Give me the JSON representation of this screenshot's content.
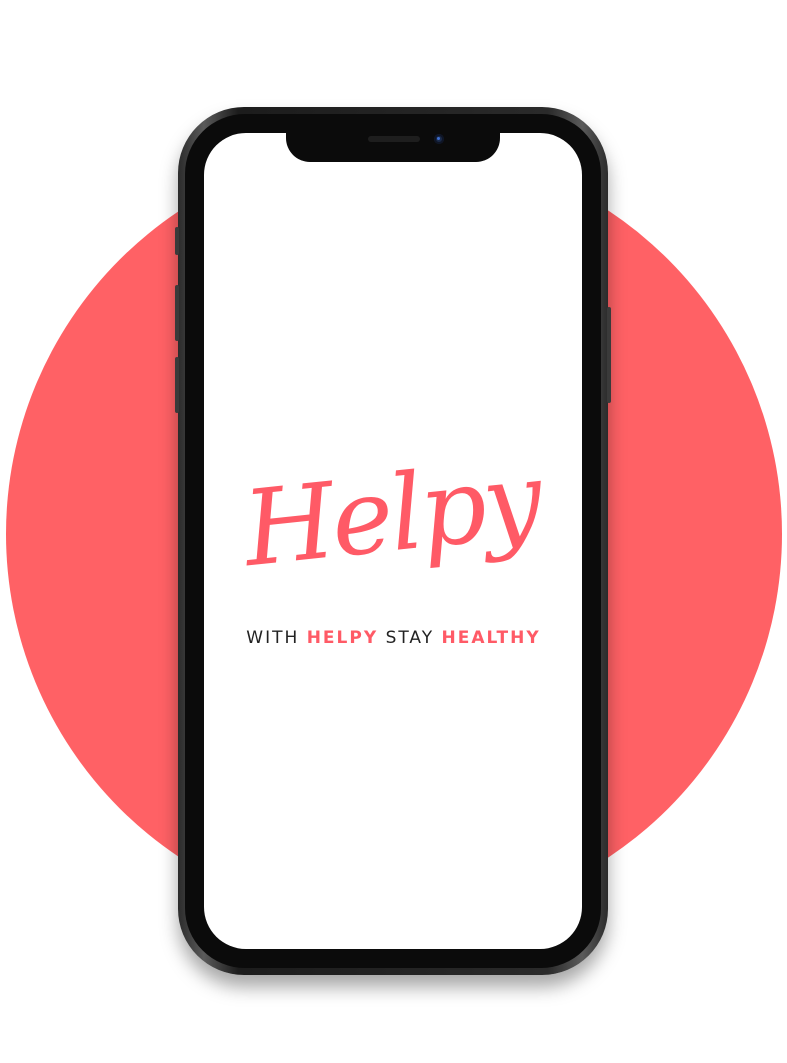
{
  "app": {
    "name": "Helpy"
  },
  "splash": {
    "logo_text": "Helpy",
    "tagline": {
      "part1": "WITH",
      "part2": "HELPY",
      "part3": "STAY",
      "part4": "HEALTHY"
    }
  },
  "colors": {
    "brand": "#ff5a66",
    "background_circle": "#ff6165",
    "phone_frame": "#1c1c1c",
    "screen": "#ffffff",
    "text_dark": "#222222"
  },
  "icons": {
    "front_camera": "camera-icon",
    "earpiece": "speaker-icon"
  }
}
